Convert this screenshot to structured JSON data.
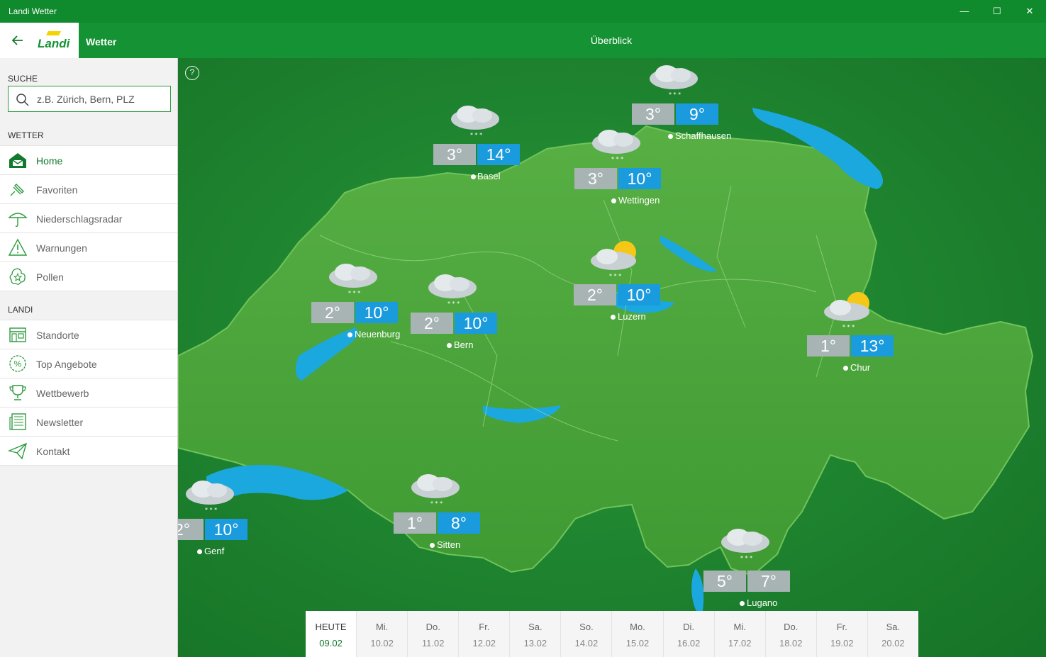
{
  "window": {
    "title": "Landi Wetter",
    "min_icon": "minimize-icon",
    "max_icon": "maximize-icon",
    "close_icon": "close-icon"
  },
  "header": {
    "logo": "LANDI",
    "section": "Wetter",
    "page_title": "Überblick"
  },
  "sidebar": {
    "search_heading": "SUCHE",
    "search_placeholder": "z.B. Zürich, Bern, PLZ",
    "weather_heading": "WETTER",
    "weather_items": [
      {
        "label": "Home",
        "icon": "home-icon",
        "active": true
      },
      {
        "label": "Favoriten",
        "icon": "favorites-icon"
      },
      {
        "label": "Niederschlagsradar",
        "icon": "umbrella-icon"
      },
      {
        "label": "Warnungen",
        "icon": "warning-icon"
      },
      {
        "label": "Pollen",
        "icon": "pollen-icon"
      }
    ],
    "landi_heading": "LANDI",
    "landi_items": [
      {
        "label": "Standorte",
        "icon": "store-icon"
      },
      {
        "label": "Top Angebote",
        "icon": "percent-icon"
      },
      {
        "label": "Wettbewerb",
        "icon": "trophy-icon"
      },
      {
        "label": "Newsletter",
        "icon": "newspaper-icon"
      },
      {
        "label": "Kontakt",
        "icon": "paper-plane-icon"
      }
    ]
  },
  "map": {
    "help": "?",
    "cities": [
      {
        "name": "Basel",
        "min": "3°",
        "max": "14°",
        "weather": "snow-cloud"
      },
      {
        "name": "Schaffhausen",
        "min": "3°",
        "max": "9°",
        "weather": "snow-cloud"
      },
      {
        "name": "Wettingen",
        "min": "3°",
        "max": "10°",
        "weather": "snow-cloud"
      },
      {
        "name": "Neuenburg",
        "min": "2°",
        "max": "10°",
        "weather": "snow-cloud"
      },
      {
        "name": "Bern",
        "min": "2°",
        "max": "10°",
        "weather": "snow-cloud"
      },
      {
        "name": "Luzern",
        "min": "2°",
        "max": "10°",
        "weather": "sun-cloud-snow"
      },
      {
        "name": "Chur",
        "min": "1°",
        "max": "13°",
        "weather": "sun-cloud-snow"
      },
      {
        "name": "Genf",
        "min": "2°",
        "max": "10°",
        "weather": "snow-cloud"
      },
      {
        "name": "Sitten",
        "min": "1°",
        "max": "8°",
        "weather": "snow-cloud"
      },
      {
        "name": "Lugano",
        "min": "5°",
        "max": "7°",
        "weather": "snow-cloud"
      }
    ]
  },
  "days": [
    {
      "name": "HEUTE",
      "date": "09.02",
      "active": true
    },
    {
      "name": "Mi.",
      "date": "10.02"
    },
    {
      "name": "Do.",
      "date": "11.02"
    },
    {
      "name": "Fr.",
      "date": "12.02"
    },
    {
      "name": "Sa.",
      "date": "13.02"
    },
    {
      "name": "So.",
      "date": "14.02"
    },
    {
      "name": "Mo.",
      "date": "15.02"
    },
    {
      "name": "Di.",
      "date": "16.02"
    },
    {
      "name": "Mi.",
      "date": "17.02"
    },
    {
      "name": "Do.",
      "date": "18.02"
    },
    {
      "name": "Fr.",
      "date": "19.02"
    },
    {
      "name": "Sa.",
      "date": "20.02"
    }
  ],
  "colors": {
    "brand_green": "#159233",
    "title_green": "#0f8a2c",
    "temp_max": "#1a9bdd",
    "temp_min": "#a8b4b4",
    "lake": "#1ba8de"
  }
}
